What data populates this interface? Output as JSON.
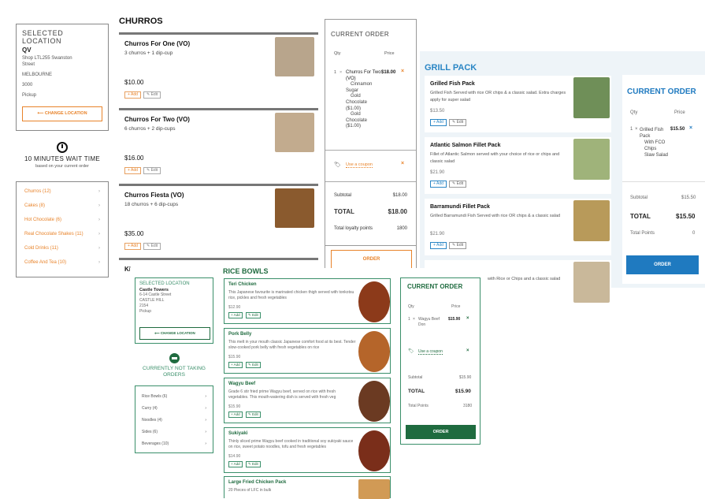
{
  "churros_site": {
    "location": {
      "heading": "SELECTED LOCATION",
      "name": "QV",
      "address_1": "Shop LTL255 Swanston",
      "address_2": "Street",
      "city": "MELBOURNE",
      "postcode": "3000",
      "mode": "Pickup",
      "change_button": "⟵ CHANGE LOCATION"
    },
    "wait": {
      "title": "10 MINUTES WAIT TIME",
      "subtitle": "based on your current order"
    },
    "categories": [
      "Churros (12)",
      "Cakes (8)",
      "Hot Chocolate (6)",
      "Real Chocolate Shakes (11)",
      "Cold Drinks (11)",
      "Coffee And Tea (10)"
    ],
    "menu_title": "CHURROS",
    "items": [
      {
        "name": "Churros For One (VO)",
        "desc": "3 churros + 1 dip-cup",
        "price": "$10.00"
      },
      {
        "name": "Churros For Two (VO)",
        "desc": "6 churros + 2 dip-cups",
        "price": "$16.00"
      },
      {
        "name": "Churros Fiesta (VO)",
        "desc": "18 churros + 6 dip-cups",
        "price": "$35.00"
      },
      {
        "name": "Ki"
      }
    ],
    "add_label": "+ Add",
    "edit_label": "✎ Edit",
    "order": {
      "title": "CURRENT ORDER",
      "qty_header": "Qty",
      "price_header": "Price",
      "line_qty": "1",
      "line_x": "×",
      "line_item": "Churros For Two (VO)",
      "line_mods": "Cinnamon Sugar · Gold Chocolate ($1.00) · Gold Chocolate ($1.00)",
      "mod_1": "Cinnamon",
      "mod_2": "Sugar",
      "mod_3": "Gold",
      "mod_4": "Chocolate",
      "mod_5": "($1.00)",
      "mod_6": "Gold",
      "mod_7": "Chocolate",
      "mod_8": "($1.00)",
      "line_price": "$18.00",
      "remove": "×",
      "coupon": "Use a coupon",
      "subtotal_label": "Subtotal",
      "subtotal": "$18.00",
      "total_label": "TOTAL",
      "total": "$18.00",
      "loyalty_label": "Total loyalty points",
      "loyalty": "1800",
      "order_button": "ORDER"
    }
  },
  "grill_site": {
    "title": "GRILL PACK",
    "items": [
      {
        "name": "Grilled Fish Pack",
        "desc": "Grilled Fish Served with rice OR chips & a classic salad. Extra charges apply for super salad",
        "price": "$13.50"
      },
      {
        "name": "Atlantic Salmon Fillet Pack",
        "desc": "Fillet of Atlantic Salmon served with your choice of rice or chips and classic salad",
        "price": "$21.90"
      },
      {
        "name": "Barramundi Fillet Pack",
        "desc": "Grilled Barramundi Fish Served with rice OR chips & a classic salad",
        "price": "$21.90"
      },
      {
        "desc": "with Rice or Chips and a classic salad"
      }
    ],
    "add_label": "+ Add",
    "edit_label": "✎ Edit",
    "order": {
      "title": "CURRENT ORDER",
      "qty_header": "Qty",
      "price_header": "Price",
      "line_qty": "1",
      "line_x": "×",
      "line_item": "Grilled Fish Pack",
      "mod_1": "With FCO",
      "mod_2": "Chips",
      "mod_3": "Slaw Salad",
      "line_price": "$15.50",
      "remove": "×",
      "subtotal_label": "Subtotal",
      "subtotal": "$15.50",
      "total_label": "TOTAL",
      "total": "$15.50",
      "points_label": "Total Points",
      "points": "0",
      "order_button": "ORDER"
    }
  },
  "rice_site": {
    "location": {
      "heading": "SELECTED LOCATION",
      "name": "Castle Towers",
      "address_1": "6-14 Castle Street",
      "address_2": "CASTLE HILL",
      "postcode": "2154",
      "mode": "Pickup",
      "change_button": "⟵ CHANGE LOCATION"
    },
    "status": "CURRENTLY NOT TAKING ORDERS",
    "categories": [
      "Rice Bowls (6)",
      "Curry (4)",
      "Noodles (4)",
      "Sides (6)",
      "Beverages (10)"
    ],
    "title": "RICE BOWLS",
    "items": [
      {
        "name": "Teri Chicken",
        "desc": "This Japanese favourite is marinated chicken thigh served with tonkotsu rice, pickles and fresh vegetables",
        "price": "$12.90"
      },
      {
        "name": "Pork Belly",
        "desc": "This melt in your mouth classic Japanese comfort food at its best. Tender slow-cooked pork belly with fresh vegetables on rice",
        "price": "$15.90"
      },
      {
        "name": "Wagyu Beef",
        "desc": "Grade 6 stir fried prime Wagyu beef, served on rice with fresh vegetables. This mouth-watering dish is served with fresh veg",
        "price": "$15.90"
      },
      {
        "name": "Sukiyaki",
        "desc": "Thinly sliced prime Wagyu beef cooked in traditional soy sukiyaki sauce on rice, sweet potato noodles, tofu and fresh vegetables",
        "price": "$14.90"
      },
      {
        "name": "Large Fried Chicken Pack",
        "desc": "20 Pieces of LFC in bulk"
      }
    ],
    "add_label": "+ Add",
    "edit_label": "✎ Edit",
    "order": {
      "title": "CURRENT ORDER",
      "qty_header": "Qty",
      "price_header": "Price",
      "line_qty": "1",
      "line_x": "×",
      "line_item": "Wagyu Beef Don",
      "line_price": "$15.90",
      "remove": "×",
      "coupon": "Use a coupon",
      "subtotal_label": "Subtotal",
      "subtotal": "$15.90",
      "total_label": "TOTAL",
      "total": "$15.90",
      "points_label": "Total Points",
      "points": "3180",
      "order_button": "ORDER"
    }
  },
  "colors": {
    "churros_accent": "#e8832a",
    "grill_accent": "#2a86c5",
    "rice_accent": "#1f6b3f"
  }
}
